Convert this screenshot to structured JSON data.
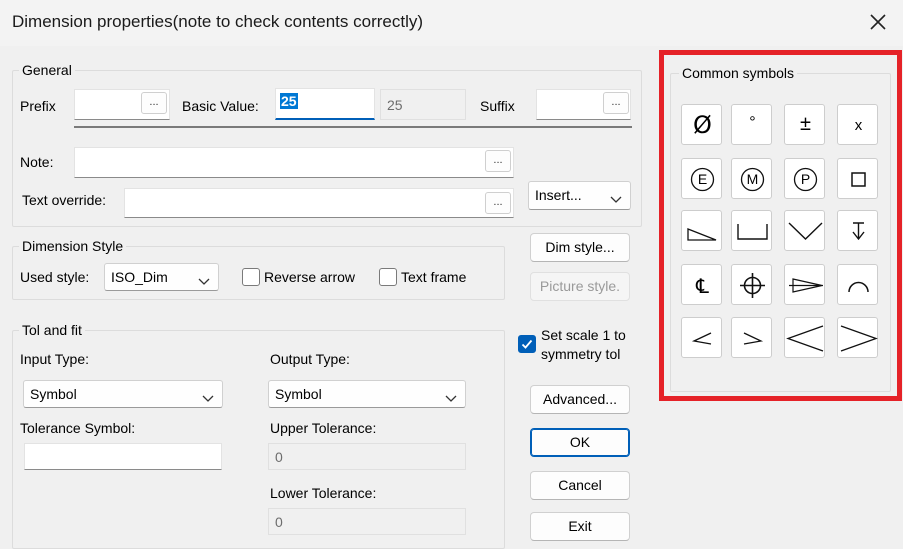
{
  "window": {
    "title": "Dimension properties(note to check contents correctly)"
  },
  "general": {
    "group_label": "General",
    "prefix_label": "Prefix",
    "prefix_value": "",
    "basic_value_label": "Basic Value:",
    "basic_value": "25",
    "basic_value_readout": "25",
    "suffix_label": "Suffix",
    "suffix_value": "",
    "note_label": "Note:",
    "note_value": "",
    "text_override_label": "Text override:",
    "text_override_value": "",
    "browse_label": "...",
    "insert_selected": "Insert..."
  },
  "dimension_style": {
    "group_label": "Dimension Style",
    "used_style_label": "Used style:",
    "used_style_selected": "ISO_Dim",
    "reverse_arrow_label": "Reverse arrow",
    "reverse_arrow_checked": false,
    "text_frame_label": "Text frame",
    "text_frame_checked": false
  },
  "tol_fit": {
    "group_label": "Tol and fit",
    "input_type_label": "Input Type:",
    "input_type_selected": "Symbol",
    "output_type_label": "Output Type:",
    "output_type_selected": "Symbol",
    "tolerance_symbol_label": "Tolerance Symbol:",
    "tolerance_symbol_value": "",
    "upper_tolerance_label": "Upper Tolerance:",
    "upper_tolerance_value": "0",
    "lower_tolerance_label": "Lower Tolerance:",
    "lower_tolerance_value": "0"
  },
  "buttons": {
    "dim_style": "Dim style...",
    "picture_style": "Picture style.",
    "set_scale_line1": "Set scale 1 to",
    "set_scale_line2": "symmetry tol",
    "set_scale_checked": true,
    "advanced": "Advanced...",
    "ok": "OK",
    "cancel": "Cancel",
    "exit": "Exit"
  },
  "common_symbols": {
    "group_label": "Common symbols",
    "items": [
      {
        "icon": "diameter-icon",
        "glyph": "Ø"
      },
      {
        "icon": "degree-icon",
        "glyph": "°"
      },
      {
        "icon": "plus-minus-icon",
        "glyph": "±"
      },
      {
        "icon": "multiply-icon",
        "glyph": "x"
      },
      {
        "icon": "circled-e-icon",
        "glyph": "E"
      },
      {
        "icon": "circled-m-icon",
        "glyph": "M"
      },
      {
        "icon": "circled-p-icon",
        "glyph": "P"
      },
      {
        "icon": "square-icon",
        "glyph": ""
      },
      {
        "icon": "slope-icon",
        "glyph": ""
      },
      {
        "icon": "counterbore-icon",
        "glyph": ""
      },
      {
        "icon": "countersink-icon",
        "glyph": ""
      },
      {
        "icon": "depth-icon",
        "glyph": ""
      },
      {
        "icon": "centerline-icon",
        "glyph": "℄"
      },
      {
        "icon": "target-point-icon",
        "glyph": ""
      },
      {
        "icon": "conical-taper-icon",
        "glyph": ""
      },
      {
        "icon": "arc-length-icon",
        "glyph": ""
      },
      {
        "icon": "small-angle-left-icon",
        "glyph": ""
      },
      {
        "icon": "small-angle-right-icon",
        "glyph": ""
      },
      {
        "icon": "less-than-icon",
        "glyph": ""
      },
      {
        "icon": "greater-than-icon",
        "glyph": ""
      }
    ]
  },
  "colors": {
    "accent": "#005fb8",
    "highlight": "#e52228",
    "selection": "#0078d4"
  }
}
